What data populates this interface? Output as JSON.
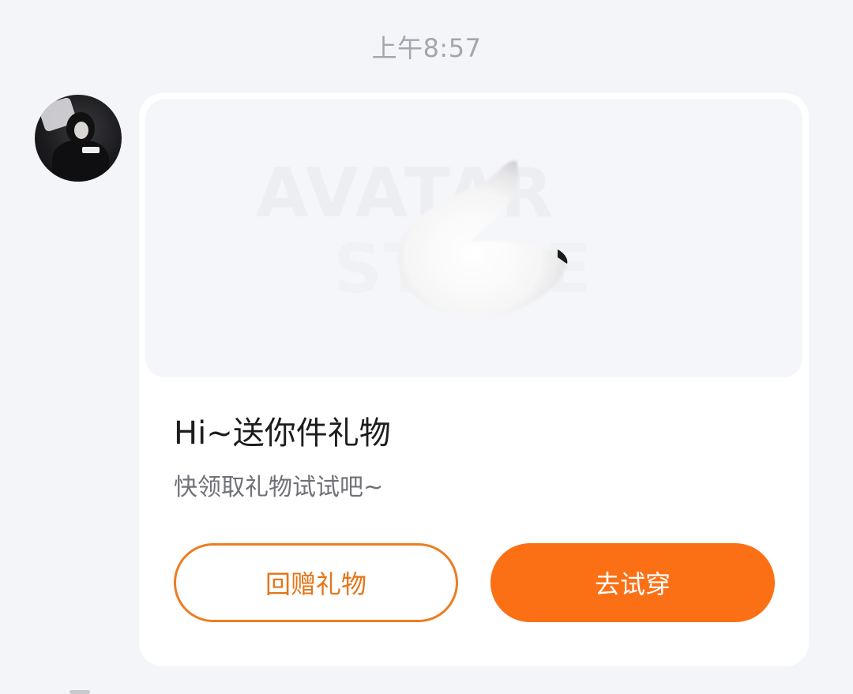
{
  "timestamp": "上午8:57",
  "sender": {
    "avatar_icon": "user-avatar"
  },
  "gift_card": {
    "preview": {
      "watermark_line1": "AVATAR",
      "watermark_line2": "STORE",
      "item_icon": "fox-tail-icon"
    },
    "title": "Hi~送你件礼物",
    "subtitle": "快领取礼物试试吧~",
    "secondary_button_label": "回赠礼物",
    "primary_button_label": "去试穿",
    "colors": {
      "accent": "#fb7015",
      "accent_outline": "#ec7d22",
      "background": "#f4f5f9",
      "card": "#ffffff"
    }
  }
}
